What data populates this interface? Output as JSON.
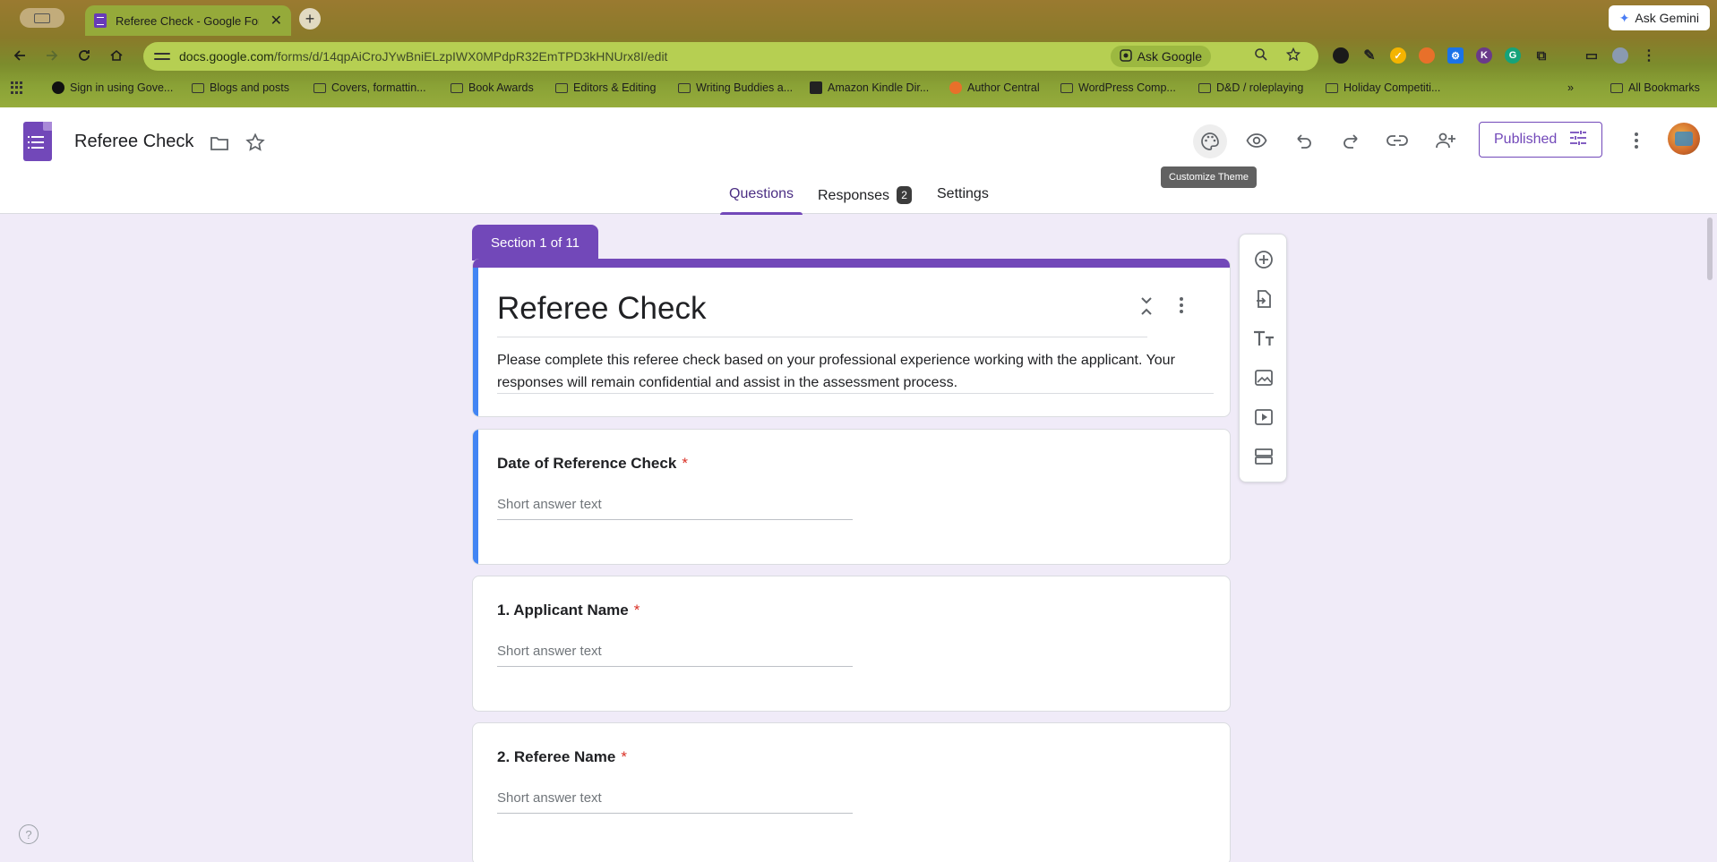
{
  "browser": {
    "tab_title": "Referee Check - Google Forms",
    "tab_close": "✕",
    "new_tab": "+",
    "ask_gemini": "Ask Gemini",
    "url_host": "docs.google.com",
    "url_path": "/forms/d/14qpAiCroJYwBniELzpIWX0MPdpR32EmTPD3kHNUrx8I/edit",
    "ask_google": "Ask Google",
    "bookmarks": [
      "Sign in using Gove...",
      "Blogs and posts",
      "Covers, formattin...",
      "Book Awards",
      "Editors & Editing",
      "Writing Buddies a...",
      "Amazon Kindle Dir...",
      "Author Central",
      "WordPress Comp...",
      "D&D / roleplaying",
      "Holiday Competiti..."
    ],
    "more_bookmarks": "»",
    "all_bookmarks": "All Bookmarks"
  },
  "header": {
    "doc_title": "Referee Check",
    "published_label": "Published",
    "tooltip": "Customize Theme"
  },
  "tabs": {
    "questions": "Questions",
    "responses": "Responses",
    "responses_count": "2",
    "settings": "Settings"
  },
  "form": {
    "section_label": "Section 1 of 11",
    "title": "Referee Check",
    "description": "Please complete this referee check based on your professional experience working with the applicant. Your responses will remain confidential and assist in the assessment process.",
    "questions": [
      {
        "label": "Date of Reference Check",
        "required_mark": "*",
        "placeholder": "Short answer text"
      },
      {
        "label": "1. Applicant Name",
        "required_mark": "*",
        "placeholder": "Short answer text"
      },
      {
        "label": "2. Referee Name",
        "required_mark": "*",
        "placeholder": "Short answer text"
      }
    ]
  },
  "help": "?",
  "colors": {
    "brand_purple": "#7248b9",
    "page_bg": "#f0ebf8",
    "focus_blue": "#4285f4",
    "required_red": "#d93025"
  }
}
